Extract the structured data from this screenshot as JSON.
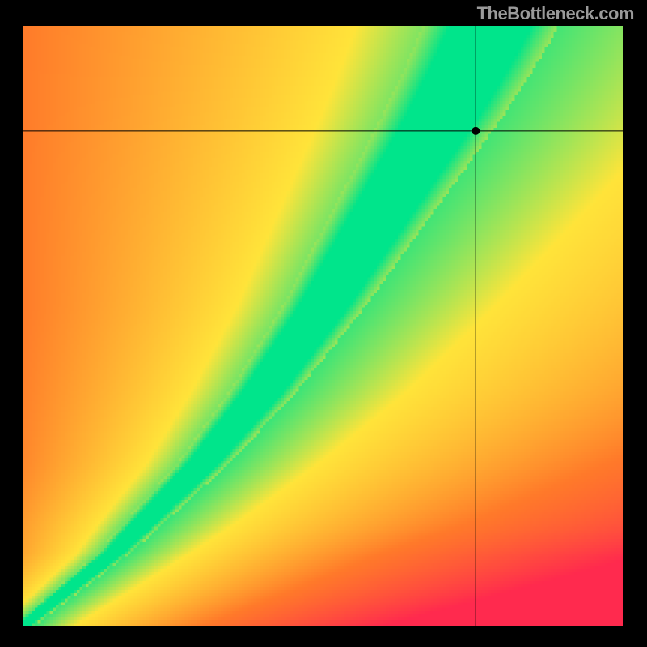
{
  "attribution": "TheBottleneck.com",
  "colors": {
    "black": "#000000",
    "attribution_gray": "#9a9a9a",
    "red": "#ff2a4e",
    "orange": "#ff7a2a",
    "yellow": "#ffe43a",
    "green": "#00e58b"
  },
  "chart_data": {
    "type": "heatmap",
    "title": "",
    "xlabel": "",
    "ylabel": "",
    "xlim": [
      0,
      1
    ],
    "ylim": [
      0,
      1
    ],
    "ridge": [
      {
        "x": 0.0,
        "y": 0.0,
        "w": 0.008
      },
      {
        "x": 0.05,
        "y": 0.04,
        "w": 0.01
      },
      {
        "x": 0.1,
        "y": 0.08,
        "w": 0.012
      },
      {
        "x": 0.15,
        "y": 0.12,
        "w": 0.014
      },
      {
        "x": 0.2,
        "y": 0.17,
        "w": 0.018
      },
      {
        "x": 0.25,
        "y": 0.22,
        "w": 0.021
      },
      {
        "x": 0.3,
        "y": 0.27,
        "w": 0.024
      },
      {
        "x": 0.35,
        "y": 0.33,
        "w": 0.028
      },
      {
        "x": 0.4,
        "y": 0.39,
        "w": 0.032
      },
      {
        "x": 0.45,
        "y": 0.46,
        "w": 0.036
      },
      {
        "x": 0.5,
        "y": 0.53,
        "w": 0.04
      },
      {
        "x": 0.55,
        "y": 0.61,
        "w": 0.045
      },
      {
        "x": 0.6,
        "y": 0.69,
        "w": 0.05
      },
      {
        "x": 0.65,
        "y": 0.77,
        "w": 0.055
      },
      {
        "x": 0.7,
        "y": 0.85,
        "w": 0.06
      },
      {
        "x": 0.75,
        "y": 0.94,
        "w": 0.065
      },
      {
        "x": 0.78,
        "y": 1.0,
        "w": 0.068
      }
    ],
    "crosshair": {
      "x": 0.755,
      "y": 0.825
    },
    "marker_radius": 5
  }
}
